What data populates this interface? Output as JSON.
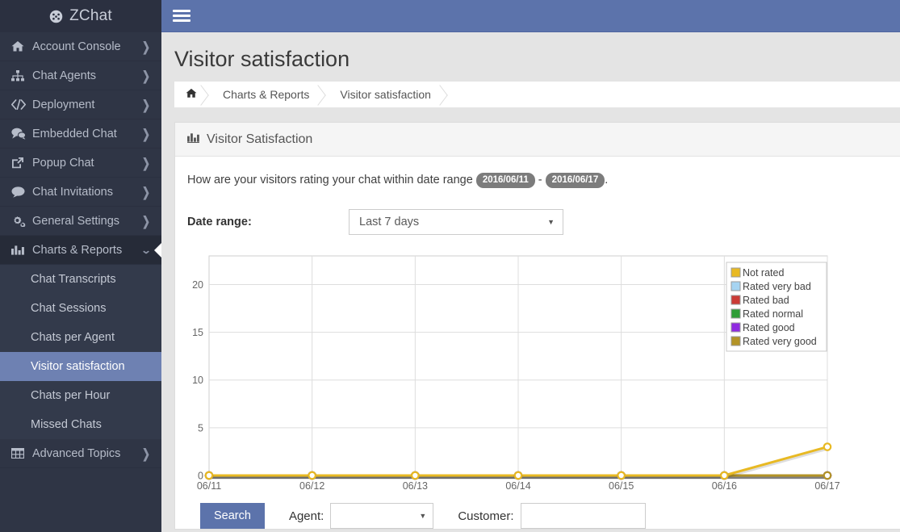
{
  "brand": {
    "name": "ZChat",
    "icon": "dashboard-icon"
  },
  "sidebar": {
    "items": [
      {
        "label": "Account Console",
        "icon": "home-icon",
        "chevron": "❯"
      },
      {
        "label": "Chat Agents",
        "icon": "sitemap-icon",
        "chevron": "❯"
      },
      {
        "label": "Deployment",
        "icon": "code-icon",
        "chevron": "❯"
      },
      {
        "label": "Embedded Chat",
        "icon": "comments-icon",
        "chevron": "❯"
      },
      {
        "label": "Popup Chat",
        "icon": "external-link-icon",
        "chevron": "❯"
      },
      {
        "label": "Chat Invitations",
        "icon": "comment-icon",
        "chevron": "❯"
      },
      {
        "label": "General Settings",
        "icon": "cogs-icon",
        "chevron": "❯"
      },
      {
        "label": "Charts & Reports",
        "icon": "bar-chart-icon",
        "chevron": "❯",
        "open": true
      },
      {
        "label": "Advanced Topics",
        "icon": "table-icon",
        "chevron": "❯"
      }
    ],
    "submenu": [
      {
        "label": "Chat Transcripts"
      },
      {
        "label": "Chat Sessions"
      },
      {
        "label": "Chats per Agent"
      },
      {
        "label": "Visitor satisfaction",
        "active": true
      },
      {
        "label": "Chats per Hour"
      },
      {
        "label": "Missed Chats"
      }
    ]
  },
  "topbar": {
    "menu_icon": "hamburger-icon"
  },
  "page": {
    "title": "Visitor satisfaction"
  },
  "breadcrumb": {
    "home_icon": "",
    "items": [
      {
        "label": "Charts & Reports"
      },
      {
        "label": "Visitor satisfaction"
      }
    ]
  },
  "panel": {
    "icon": "bar-chart-icon",
    "title": "Visitor Satisfaction",
    "lead_before": "How are your visitors rating your chat within date range",
    "date_from": "2016/06/11",
    "lead_sep": "-",
    "date_to": "2016/06/17",
    "lead_after": "."
  },
  "filters": {
    "date_range_label": "Date range:",
    "date_range_value": "Last 7 days",
    "caret": "▼"
  },
  "bottom_form": {
    "search_label": "Search",
    "agent_label": "Agent:",
    "agent_value": "",
    "customer_label": "Customer:",
    "customer_value": "",
    "customer_placeholder": "",
    "caret": "▼"
  },
  "chart_data": {
    "type": "line",
    "title": "",
    "xlabel": "",
    "ylabel": "",
    "categories": [
      "06/11",
      "06/12",
      "06/13",
      "06/14",
      "06/15",
      "06/16",
      "06/17"
    ],
    "ylim": [
      0,
      23
    ],
    "yticks": [
      0,
      5,
      10,
      15,
      20
    ],
    "grid": true,
    "legend_position": "top-right",
    "series": [
      {
        "name": "Not rated",
        "color": "#e8b923",
        "values": [
          0,
          0,
          0,
          0,
          0,
          0,
          3
        ]
      },
      {
        "name": "Rated very bad",
        "color": "#a6d4f2",
        "values": [
          0,
          0,
          0,
          0,
          0,
          0,
          0
        ]
      },
      {
        "name": "Rated bad",
        "color": "#cb3b36",
        "values": [
          0,
          0,
          0,
          0,
          0,
          0,
          0
        ]
      },
      {
        "name": "Rated normal",
        "color": "#2f9e37",
        "values": [
          0,
          0,
          0,
          0,
          0,
          0,
          0
        ]
      },
      {
        "name": "Rated good",
        "color": "#8f2be0",
        "values": [
          0,
          0,
          0,
          0,
          0,
          0,
          0
        ]
      },
      {
        "name": "Rated very good",
        "color": "#b39326",
        "values": [
          0,
          0,
          0,
          0,
          0,
          0,
          0
        ]
      }
    ]
  }
}
